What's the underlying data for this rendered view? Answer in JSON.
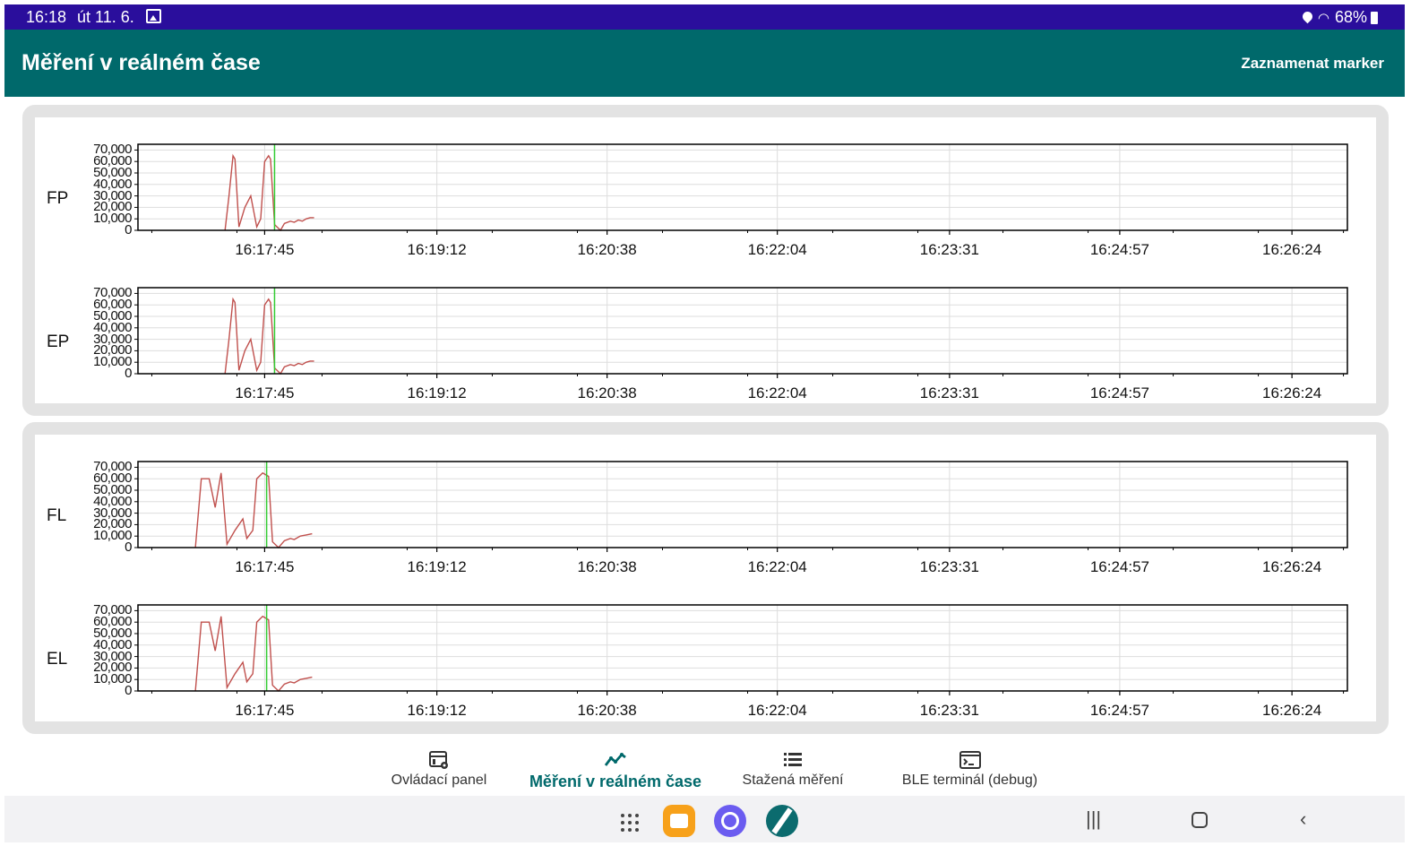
{
  "status_bar": {
    "time": "16:18",
    "date": "út 11. 6.",
    "battery": "68%"
  },
  "app_bar": {
    "title": "Měření v reálném čase",
    "action": "Zaznamenat marker"
  },
  "y_ticks": [
    "70,000",
    "60,000",
    "50,000",
    "40,000",
    "30,000",
    "20,000",
    "10,000",
    "0"
  ],
  "x_ticks": [
    "16:17:45",
    "16:19:12",
    "16:20:38",
    "16:22:04",
    "16:23:31",
    "16:24:57",
    "16:26:24"
  ],
  "colors": {
    "status_bar": "#2a0e9c",
    "app_bar": "#00696b",
    "series": "#c0504d",
    "marker": "#33cc33",
    "card_border": "#e3e3e3"
  },
  "chart_data": [
    {
      "type": "line",
      "label": "FP",
      "ylim": [
        0,
        75000
      ],
      "x": [
        "16:17:25",
        "16:17:27",
        "16:17:29",
        "16:17:30",
        "16:17:32",
        "16:17:35",
        "16:17:38",
        "16:17:41",
        "16:17:43",
        "16:17:45",
        "16:17:47",
        "16:17:48",
        "16:17:50",
        "16:17:53",
        "16:17:55",
        "16:17:58",
        "16:18:00",
        "16:18:02",
        "16:18:04",
        "16:18:06",
        "16:18:08",
        "16:18:10"
      ],
      "values": [
        0,
        30000,
        65000,
        62000,
        3000,
        20000,
        30000,
        3000,
        10000,
        60000,
        65000,
        62000,
        5000,
        0,
        6000,
        8000,
        7000,
        9000,
        8000,
        10000,
        11000,
        11000
      ],
      "marker_x": "16:17:50"
    },
    {
      "type": "line",
      "label": "EP",
      "ylim": [
        0,
        75000
      ],
      "x": [
        "16:17:25",
        "16:17:27",
        "16:17:29",
        "16:17:30",
        "16:17:32",
        "16:17:35",
        "16:17:38",
        "16:17:41",
        "16:17:43",
        "16:17:45",
        "16:17:47",
        "16:17:48",
        "16:17:50",
        "16:17:53",
        "16:17:55",
        "16:17:58",
        "16:18:00",
        "16:18:02",
        "16:18:04",
        "16:18:06",
        "16:18:08",
        "16:18:10"
      ],
      "values": [
        0,
        30000,
        65000,
        62000,
        3000,
        20000,
        30000,
        3000,
        10000,
        60000,
        65000,
        62000,
        5000,
        0,
        6000,
        8000,
        7000,
        9000,
        8000,
        10000,
        11000,
        11000
      ],
      "marker_x": "16:17:50"
    },
    {
      "type": "line",
      "label": "FL",
      "ylim": [
        0,
        75000
      ],
      "x": [
        "16:17:10",
        "16:17:13",
        "16:17:17",
        "16:17:20",
        "16:17:23",
        "16:17:26",
        "16:17:30",
        "16:17:34",
        "16:17:36",
        "16:17:39",
        "16:17:41",
        "16:17:44",
        "16:17:47",
        "16:17:49",
        "16:17:52",
        "16:17:55",
        "16:17:58",
        "16:18:00",
        "16:18:03",
        "16:18:06",
        "16:18:09"
      ],
      "values": [
        0,
        60000,
        60000,
        35000,
        65000,
        3000,
        15000,
        25000,
        8000,
        15000,
        60000,
        65000,
        62000,
        5000,
        0,
        6000,
        8000,
        7000,
        10000,
        11000,
        12000
      ],
      "marker_x": "16:17:46"
    },
    {
      "type": "line",
      "label": "EL",
      "ylim": [
        0,
        75000
      ],
      "x": [
        "16:17:10",
        "16:17:13",
        "16:17:17",
        "16:17:20",
        "16:17:23",
        "16:17:26",
        "16:17:30",
        "16:17:34",
        "16:17:36",
        "16:17:39",
        "16:17:41",
        "16:17:44",
        "16:17:47",
        "16:17:49",
        "16:17:52",
        "16:17:55",
        "16:17:58",
        "16:18:00",
        "16:18:03",
        "16:18:06",
        "16:18:09"
      ],
      "values": [
        0,
        60000,
        60000,
        35000,
        65000,
        3000,
        15000,
        25000,
        8000,
        15000,
        60000,
        65000,
        62000,
        5000,
        0,
        6000,
        8000,
        7000,
        10000,
        11000,
        12000
      ],
      "marker_x": "16:17:46"
    }
  ],
  "bottom_nav": [
    {
      "label": "Ovládací panel",
      "icon": "dashboard-settings-icon",
      "active": false
    },
    {
      "label": "Měření v reálném čase",
      "icon": "trend-line-icon",
      "active": true
    },
    {
      "label": "Stažená měření",
      "icon": "list-icon",
      "active": false
    },
    {
      "label": "BLE terminál (debug)",
      "icon": "terminal-icon",
      "active": false
    }
  ],
  "system_nav": {
    "apps": [
      "app-drawer-icon",
      "files-app-icon",
      "internet-app-icon",
      "measurement-app-icon"
    ],
    "buttons": [
      "recent-apps-button",
      "home-button",
      "back-button"
    ]
  }
}
